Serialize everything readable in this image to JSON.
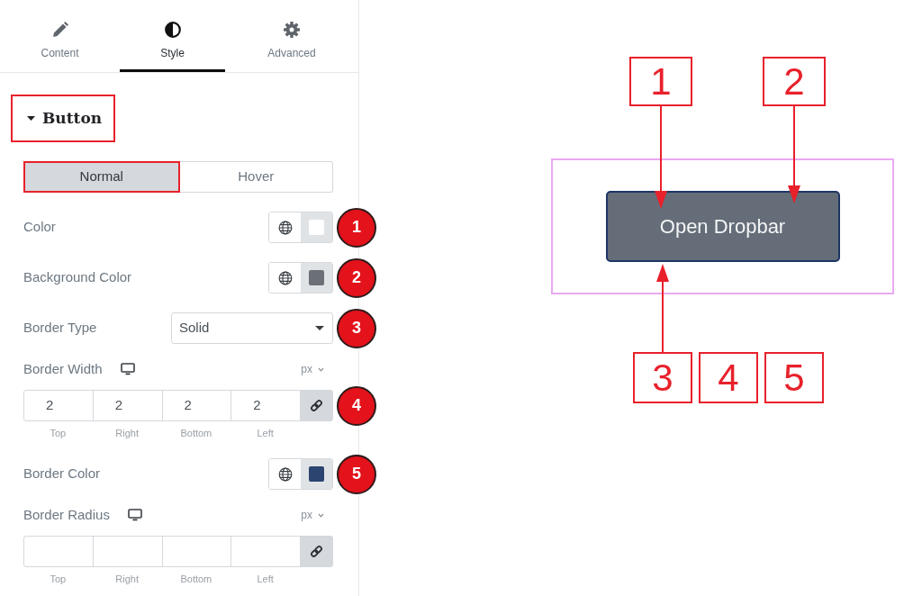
{
  "panel": {
    "tabs": [
      {
        "label": "Content",
        "selected": false
      },
      {
        "label": "Style",
        "selected": true
      },
      {
        "label": "Advanced",
        "selected": false
      }
    ],
    "section": {
      "title": "Button",
      "expanded": true,
      "annotated": true
    },
    "state_tabs": [
      {
        "label": "Normal",
        "selected": true,
        "annotated": true
      },
      {
        "label": "Hover",
        "selected": false,
        "annotated": false
      }
    ],
    "controls": [
      {
        "kind": "color",
        "label": "Color",
        "color": "#ffffff",
        "badge": "1"
      },
      {
        "kind": "color",
        "label": "Background Color",
        "color": "#6b6f76",
        "badge": "2"
      },
      {
        "kind": "select",
        "label": "Border Type",
        "value": "Solid",
        "badge": "3"
      },
      {
        "kind": "dimensions",
        "label": "Border Width",
        "unit": "px",
        "fields": [
          {
            "side": "Top",
            "value": "2"
          },
          {
            "side": "Right",
            "value": "2"
          },
          {
            "side": "Bottom",
            "value": "2"
          },
          {
            "side": "Left",
            "value": "2"
          }
        ],
        "badge": "4"
      },
      {
        "kind": "color",
        "label": "Border Color",
        "color": "#2b4470",
        "badge": "5"
      },
      {
        "kind": "dimensions",
        "label": "Border Radius",
        "unit": "px",
        "fields": [
          {
            "side": "Top"
          },
          {
            "side": "Right"
          },
          {
            "side": "Bottom"
          },
          {
            "side": "Left"
          }
        ]
      }
    ]
  },
  "preview": {
    "button_label": "Open Dropbar",
    "callouts_top": [
      {
        "label": "1",
        "arrow": true
      },
      {
        "label": "2",
        "arrow": true
      }
    ],
    "callouts_bottom": [
      {
        "label": "3",
        "arrow": true
      },
      {
        "label": "4",
        "arrow": false
      },
      {
        "label": "5",
        "arrow": false
      }
    ]
  }
}
